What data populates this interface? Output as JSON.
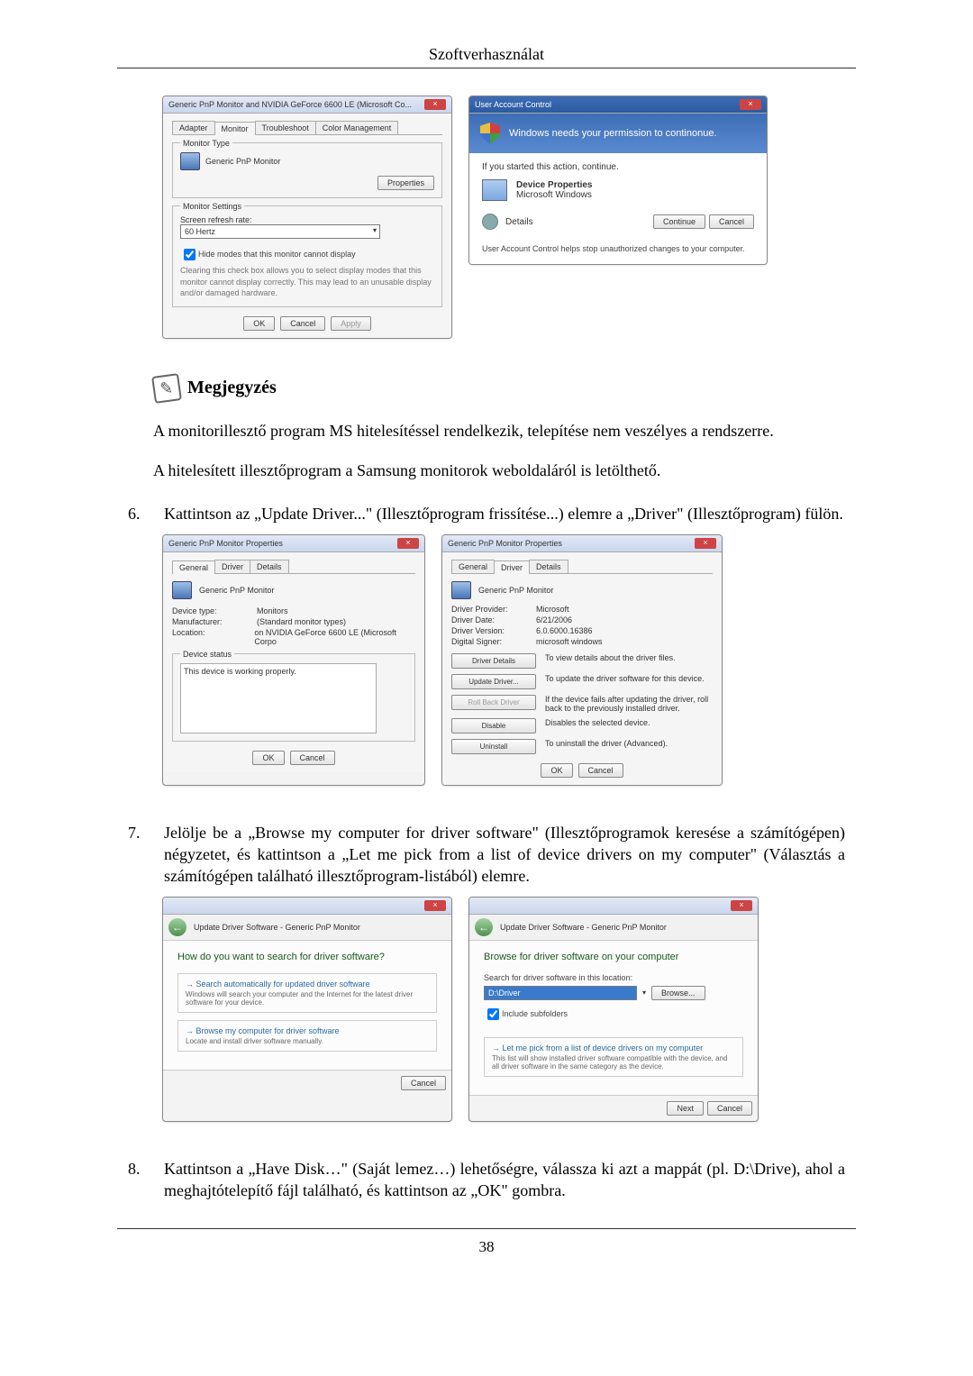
{
  "header": {
    "title": "Szoftverhasználat",
    "page_number": "38"
  },
  "win_monitor": {
    "title": "Generic PnP Monitor and NVIDIA GeForce 6600 LE (Microsoft Co...",
    "tabs": [
      "Adapter",
      "Monitor",
      "Troubleshoot",
      "Color Management"
    ],
    "section_type": "Monitor Type",
    "type_name": "Generic PnP Monitor",
    "properties_btn": "Properties",
    "section_settings": "Monitor Settings",
    "refresh_label": "Screen refresh rate:",
    "refresh_value": "60 Hertz",
    "hide_modes": "Hide modes that this monitor cannot display",
    "hide_text": "Clearing this check box allows you to select display modes that this monitor cannot display correctly. This may lead to an unusable display and/or damaged hardware.",
    "ok": "OK",
    "cancel": "Cancel",
    "apply": "Apply"
  },
  "uac": {
    "title": "User Account Control",
    "banner": "Windows needs your permission to continonue.",
    "started": "If you started this action, continue.",
    "app_name": "Device Properties",
    "app_vendor": "Microsoft Windows",
    "details": "Details",
    "continue": "Continue",
    "cancel": "Cancel",
    "foot": "User Account Control helps stop unauthorized changes to your computer."
  },
  "note": {
    "label": "Megjegyzés",
    "p1": "A monitorillesztő program MS hitelesítéssel rendelkezik, telepítése nem veszélyes a rendszerre.",
    "p2": "A hitelesített illesztőprogram a Samsung monitorok weboldaláról is letölthető."
  },
  "step6": {
    "num": "6.",
    "text": "Kattintson az „Update Driver...\" (Illesztőprogram frissítése...) elemre a „Driver\" (Illesztőprogram) fülön."
  },
  "prop_general": {
    "title": "Generic PnP Monitor Properties",
    "tabs": [
      "General",
      "Driver",
      "Details"
    ],
    "name": "Generic PnP Monitor",
    "dev_type_l": "Device type:",
    "dev_type_v": "Monitors",
    "manu_l": "Manufacturer:",
    "manu_v": "(Standard monitor types)",
    "loc_l": "Location:",
    "loc_v": "on NVIDIA GeForce 6600 LE (Microsoft Corpo",
    "status_l": "Device status",
    "status_v": "This device is working properly.",
    "ok": "OK",
    "cancel": "Cancel"
  },
  "prop_driver": {
    "title": "Generic PnP Monitor Properties",
    "tabs": [
      "General",
      "Driver",
      "Details"
    ],
    "name": "Generic PnP Monitor",
    "prov_l": "Driver Provider:",
    "prov_v": "Microsoft",
    "date_l": "Driver Date:",
    "date_v": "6/21/2006",
    "ver_l": "Driver Version:",
    "ver_v": "6.0.6000.16386",
    "sig_l": "Digital Signer:",
    "sig_v": "microsoft windows",
    "btns": {
      "details": "Driver Details",
      "details_d": "To view details about the driver files.",
      "update": "Update Driver...",
      "update_d": "To update the driver software for this device.",
      "roll": "Roll Back Driver",
      "roll_d": "If the device fails after updating the driver, roll back to the previously installed driver.",
      "disable": "Disable",
      "disable_d": "Disables the selected device.",
      "uninst": "Uninstall",
      "uninst_d": "To uninstall the driver (Advanced)."
    },
    "ok": "OK",
    "cancel": "Cancel"
  },
  "step7": {
    "num": "7.",
    "text": "Jelölje be a „Browse my computer for driver software\" (Illesztőprogramok keresése a számítógépen) négyzetet, és kattintson a „Let me pick from a list of device drivers on my computer\" (Választás a számítógépen található illesztőprogram-listából) elemre."
  },
  "wiz1": {
    "crumb": "Update Driver Software - Generic PnP Monitor",
    "title": "How do you want to search for driver software?",
    "opt1_t": "Search automatically for updated driver software",
    "opt1_s": "Windows will search your computer and the Internet for the latest driver software for your device.",
    "opt2_t": "Browse my computer for driver software",
    "opt2_s": "Locate and install driver software manually.",
    "cancel": "Cancel"
  },
  "wiz2": {
    "crumb": "Update Driver Software - Generic PnP Monitor",
    "title": "Browse for driver software on your computer",
    "search_l": "Search for driver software in this location:",
    "path": "D:\\Driver",
    "browse": "Browse...",
    "include": "Include subfolders",
    "opt_t": "Let me pick from a list of device drivers on my computer",
    "opt_s": "This list will show installed driver software compatible with the device, and all driver software in the same category as the device.",
    "next": "Next",
    "cancel": "Cancel"
  },
  "step8": {
    "num": "8.",
    "text": "Kattintson a „Have Disk…\" (Saját lemez…) lehetőségre, válassza ki azt a mappát (pl. D:\\Drive), ahol a meghajtótelepítő fájl található, és kattintson az „OK\" gombra."
  }
}
